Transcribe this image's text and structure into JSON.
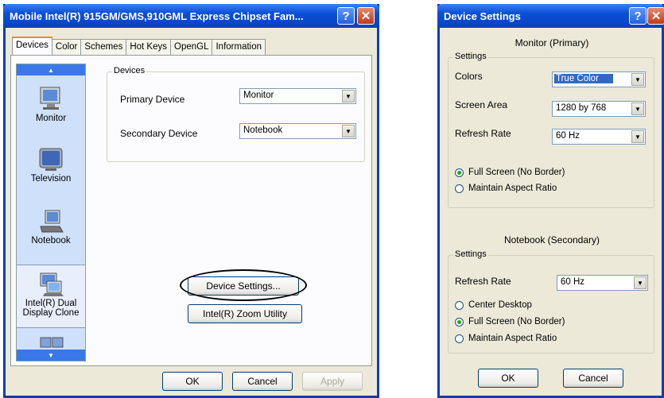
{
  "left_window": {
    "title": "Mobile Intel(R) 915GM/GMS,910GML Express Chipset Fam...",
    "help_glyph": "?",
    "close_glyph": "✕",
    "tabs": [
      "Devices",
      "Color",
      "Schemes",
      "Hot Keys",
      "OpenGL",
      "Information"
    ],
    "active_tab": "Devices",
    "sidebar": {
      "items": [
        {
          "label": "Monitor",
          "icon": "monitor-icon"
        },
        {
          "label": "Television",
          "icon": "television-icon"
        },
        {
          "label": "Notebook",
          "icon": "notebook-icon"
        },
        {
          "label": "Intel(R) Dual Display Clone",
          "label_line1": "Intel(R) Dual",
          "label_line2": "Display Clone",
          "icon": "dual-display-icon",
          "selected": true
        }
      ]
    },
    "devices_group": {
      "label": "Devices",
      "primary_label": "Primary Device",
      "primary_value": "Monitor",
      "secondary_label": "Secondary Device",
      "secondary_value": "Notebook"
    },
    "device_settings_button": "Device Settings...",
    "zoom_button": "Intel(R) Zoom Utility",
    "ok": "OK",
    "cancel": "Cancel",
    "apply": "Apply"
  },
  "right_window": {
    "title": "Device Settings",
    "help_glyph": "?",
    "close_glyph": "✕",
    "monitor_heading": "Monitor (Primary)",
    "monitor_group": {
      "label": "Settings",
      "colors_label": "Colors",
      "colors_value": "True Color",
      "area_label": "Screen Area",
      "area_value": "1280 by 768",
      "refresh_label": "Refresh Rate",
      "refresh_value": "60 Hz",
      "radio_full": "Full Screen (No Border)",
      "radio_aspect": "Maintain Aspect Ratio"
    },
    "notebook_heading": "Notebook (Secondary)",
    "notebook_group": {
      "label": "Settings",
      "refresh_label": "Refresh Rate",
      "refresh_value": "60 Hz",
      "radio_center": "Center Desktop",
      "radio_full": "Full Screen (No Border)",
      "radio_aspect": "Maintain Aspect Ratio"
    },
    "ok": "OK",
    "cancel": "Cancel"
  },
  "colors": {
    "titlebar": "#0a4fd6",
    "sidebar_bg": "#cfe0fb",
    "selection": "#316ac5"
  }
}
